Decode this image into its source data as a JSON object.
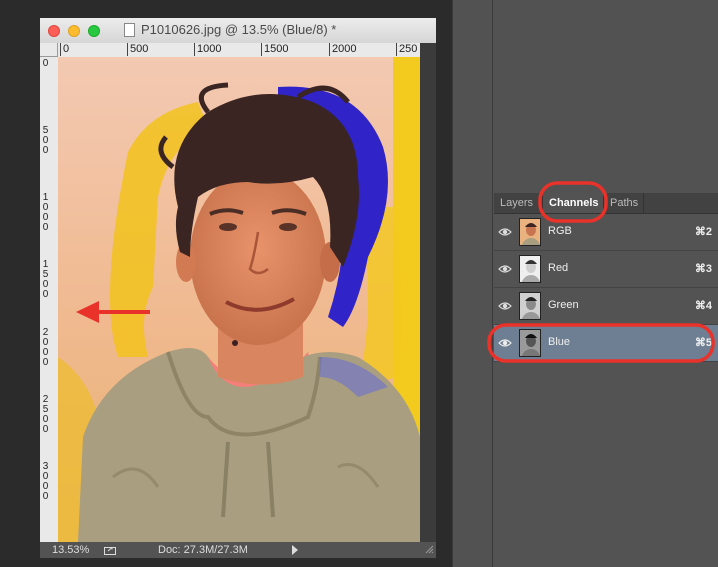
{
  "document": {
    "title": "P1010626.jpg @ 13.5% (Blue/8) *",
    "ruler_h_labels": [
      "0",
      "500",
      "1000",
      "1500",
      "2000",
      "250"
    ],
    "ruler_v_labels": [
      "0",
      "500",
      "1000",
      "1500",
      "2000",
      "2500",
      "3000"
    ],
    "status": {
      "zoom": "13.53%",
      "doc_info": "Doc: 27.3M/27.3M"
    }
  },
  "panel": {
    "tabs": [
      {
        "label": "Layers",
        "active": false
      },
      {
        "label": "Channels",
        "active": true
      },
      {
        "label": "Paths",
        "active": false
      }
    ],
    "channels": [
      {
        "name": "RGB",
        "shortcut": "⌘2",
        "visible": true,
        "selected": false
      },
      {
        "name": "Red",
        "shortcut": "⌘3",
        "visible": true,
        "selected": false
      },
      {
        "name": "Green",
        "shortcut": "⌘4",
        "visible": true,
        "selected": false
      },
      {
        "name": "Blue",
        "shortcut": "⌘5",
        "visible": true,
        "selected": true
      }
    ]
  },
  "colors": {
    "annotation": "#e8322a",
    "selected_row": "#6f7f93",
    "panel_bg": "#535353"
  }
}
